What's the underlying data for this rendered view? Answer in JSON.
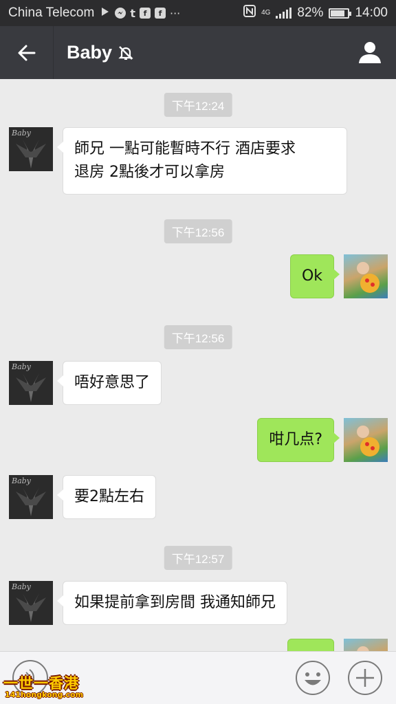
{
  "status_bar": {
    "carrier": "China Telecom",
    "network": "4G",
    "battery_percent": "82%",
    "battery_level": 0.82,
    "time": "14:00",
    "notification_icons": [
      "play-store-icon",
      "messenger-icon",
      "tumblr-icon",
      "facebook-icon",
      "facebook-icon",
      "more-icon"
    ]
  },
  "header": {
    "title": "Baby",
    "muted_icon": "bell-off-icon",
    "profile_icon": "person-icon"
  },
  "messages": [
    {
      "type": "time",
      "text": "下午12:24"
    },
    {
      "type": "received",
      "avatar_text": "Baby 師約",
      "lines": [
        "師兄 一點可能暫時不行 酒店要求",
        "退房 2點後才可以拿房"
      ]
    },
    {
      "type": "time",
      "text": "下午12:56"
    },
    {
      "type": "sent",
      "text": "Ok"
    },
    {
      "type": "time",
      "text": "下午12:56"
    },
    {
      "type": "received",
      "avatar_text": "Baby 師約",
      "text": "唔好意思了"
    },
    {
      "type": "sent",
      "text": "咁几点?"
    },
    {
      "type": "received",
      "avatar_text": "Baby 師約",
      "text": "要2點左右"
    },
    {
      "type": "time",
      "text": "下午12:57"
    },
    {
      "type": "received",
      "avatar_text": "Baby 師約",
      "text": "如果提前拿到房間 我通知師兄"
    },
    {
      "type": "sent",
      "text": ""
    }
  ],
  "input_bar": {
    "voice_icon": "voice-icon",
    "emoji_icon": "emoji-icon",
    "plus_icon": "plus-icon"
  },
  "watermark": {
    "title": "一世一香港",
    "url": "141hongkong.com"
  },
  "colors": {
    "nav_bg": "#393a3f",
    "status_bg": "#2c2c2e",
    "chat_bg": "#ebebeb",
    "sent_bubble": "#9fe65a",
    "received_bubble": "#ffffff"
  }
}
